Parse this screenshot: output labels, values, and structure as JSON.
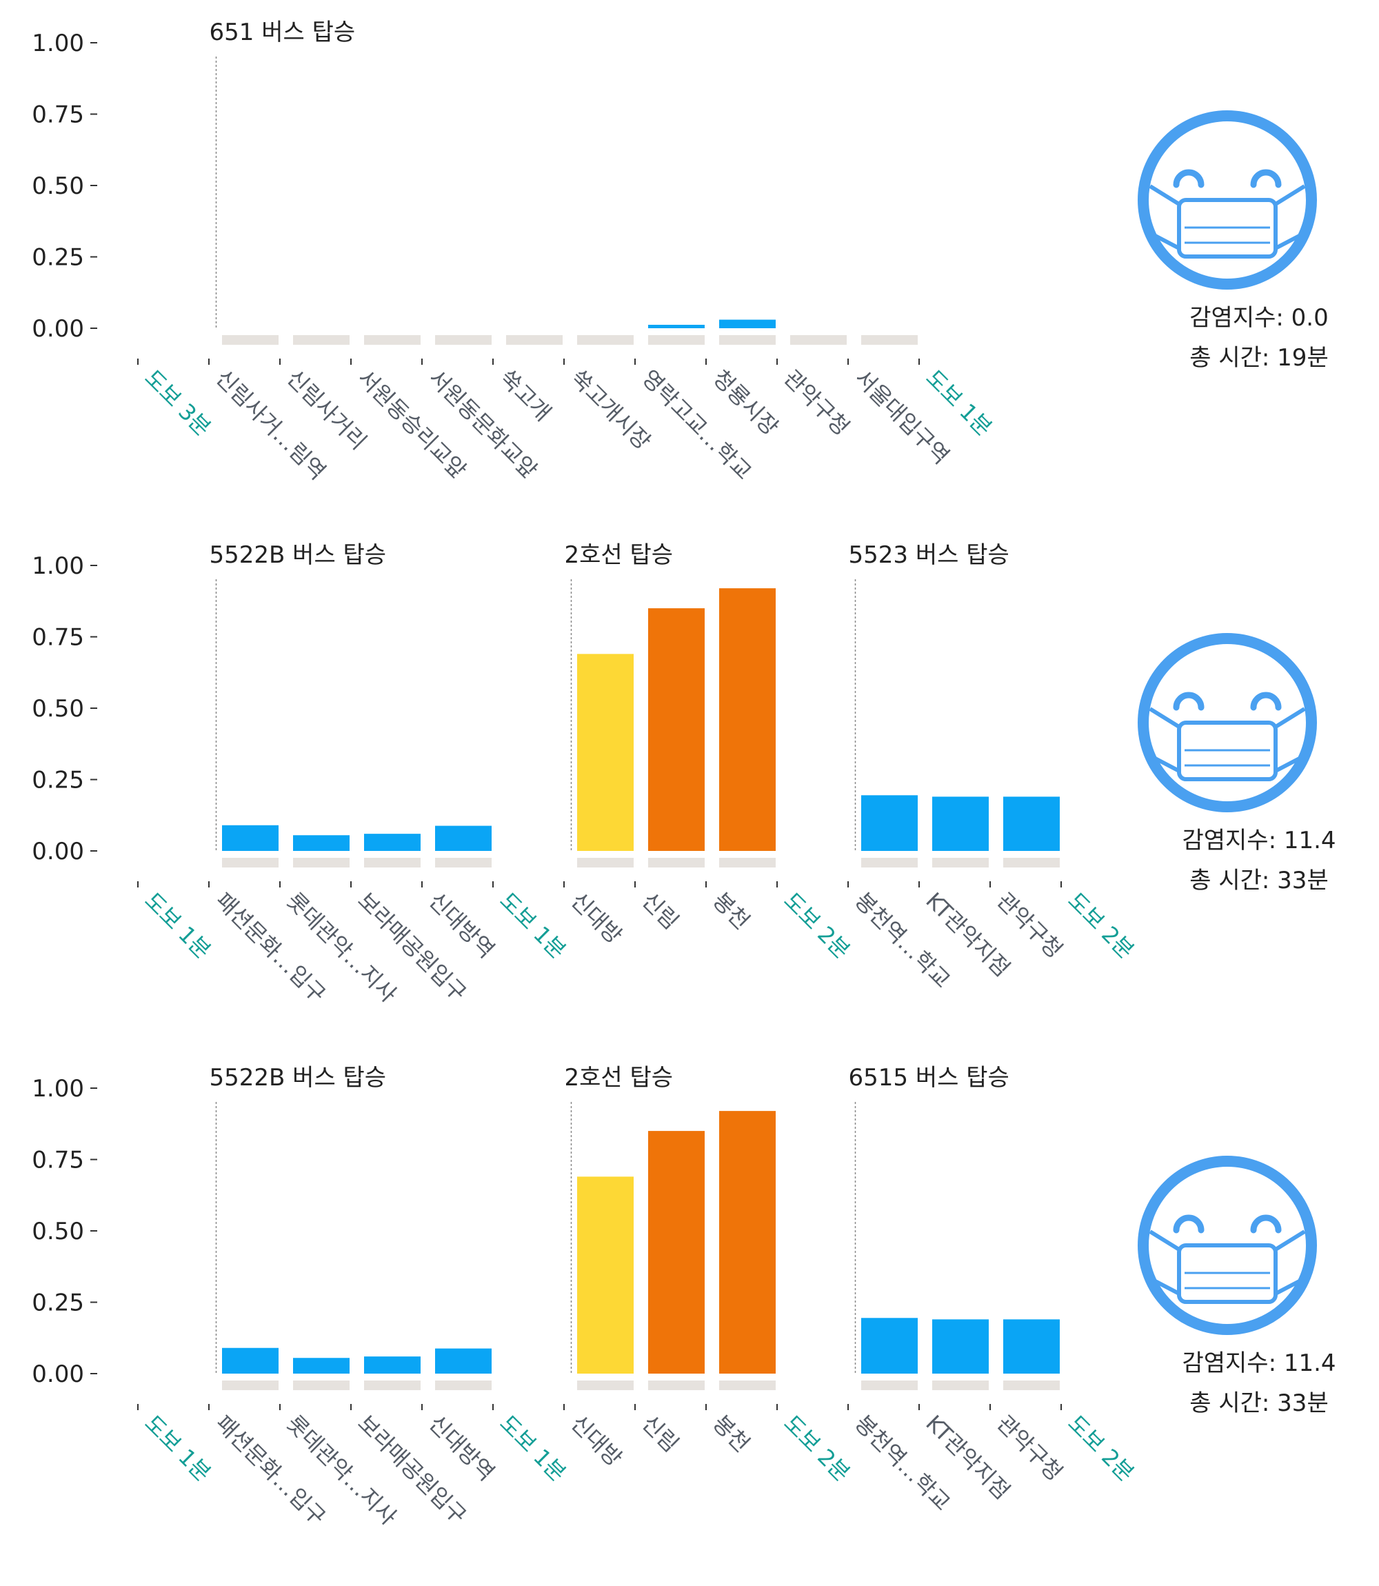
{
  "colors": {
    "bus": "#0aa5f5",
    "subway_low": "#fdd835",
    "subway_high": "#ef7409",
    "baseline": "#e6e2de",
    "walk_label": "#139e96",
    "stop_label": "#555c66",
    "icon": "#4aa0f0",
    "separator": "#888888"
  },
  "chart_data": [
    {
      "type": "bar",
      "ylim": [
        0,
        1
      ],
      "yticks": [
        "1.00",
        "0.75",
        "0.50",
        "0.25",
        "0.00"
      ],
      "walk_start": "도보 3분",
      "walk_end": "도보 1분",
      "legs": [
        {
          "label": "651 버스 탑승",
          "mode": "bus",
          "stops": [
            "신림사거…림역",
            "신림사거리",
            "서원동승리교앞",
            "서원동문화교앞",
            "쑥고개",
            "쑥고개시장",
            "영락고교…학교",
            "청룡시장",
            "관악구청",
            "서울대입구역"
          ],
          "values": [
            0,
            0,
            0,
            0,
            0,
            0,
            0.012,
            0.03,
            0,
            0
          ],
          "colors": [
            "bus",
            "bus",
            "bus",
            "bus",
            "bus",
            "bus",
            "bus",
            "bus",
            "bus",
            "bus"
          ],
          "walk_after": null
        }
      ],
      "infection_label": "감염지수: 0.0",
      "total_time_label": "총 시간: 19분",
      "icon": "mask-face-icon"
    },
    {
      "type": "bar",
      "ylim": [
        0,
        1
      ],
      "yticks": [
        "1.00",
        "0.75",
        "0.50",
        "0.25",
        "0.00"
      ],
      "walk_start": "도보 1분",
      "walk_end": "도보 2분",
      "legs": [
        {
          "label": "5522B 버스 탑승",
          "mode": "bus",
          "stops": [
            "패션문화…입구",
            "롯데관악…지사",
            "보라매공원입구",
            "신대방역"
          ],
          "values": [
            0.09,
            0.055,
            0.06,
            0.088
          ],
          "colors": [
            "bus",
            "bus",
            "bus",
            "bus"
          ],
          "walk_after": "도보 1분"
        },
        {
          "label": "2호선 탑승",
          "mode": "subway",
          "stops": [
            "신대방",
            "신림",
            "봉천"
          ],
          "values": [
            0.69,
            0.85,
            0.92
          ],
          "colors": [
            "subway_low",
            "subway_high",
            "subway_high"
          ],
          "walk_after": "도보 2분"
        },
        {
          "label": "5523 버스 탑승",
          "mode": "bus",
          "stops": [
            "봉천역…학교",
            "KT관악지점",
            "관악구청"
          ],
          "values": [
            0.195,
            0.19,
            0.19
          ],
          "colors": [
            "bus",
            "bus",
            "bus"
          ],
          "walk_after": null
        }
      ],
      "infection_label": "감염지수: 11.4",
      "total_time_label": "총 시간: 33분",
      "icon": "mask-face-icon"
    },
    {
      "type": "bar",
      "ylim": [
        0,
        1
      ],
      "yticks": [
        "1.00",
        "0.75",
        "0.50",
        "0.25",
        "0.00"
      ],
      "walk_start": "도보 1분",
      "walk_end": "도보 2분",
      "legs": [
        {
          "label": "5522B 버스 탑승",
          "mode": "bus",
          "stops": [
            "패션문화…입구",
            "롯데관악…지사",
            "보라매공원입구",
            "신대방역"
          ],
          "values": [
            0.09,
            0.055,
            0.06,
            0.088
          ],
          "colors": [
            "bus",
            "bus",
            "bus",
            "bus"
          ],
          "walk_after": "도보 1분"
        },
        {
          "label": "2호선 탑승",
          "mode": "subway",
          "stops": [
            "신대방",
            "신림",
            "봉천"
          ],
          "values": [
            0.69,
            0.85,
            0.92
          ],
          "colors": [
            "subway_low",
            "subway_high",
            "subway_high"
          ],
          "walk_after": "도보 2분"
        },
        {
          "label": "6515 버스 탑승",
          "mode": "bus",
          "stops": [
            "봉천역…학교",
            "KT관악지점",
            "관악구청"
          ],
          "values": [
            0.195,
            0.19,
            0.19
          ],
          "colors": [
            "bus",
            "bus",
            "bus"
          ],
          "walk_after": null
        }
      ],
      "infection_label": "감염지수: 11.4",
      "total_time_label": "총 시간: 33분",
      "icon": "mask-face-icon"
    }
  ]
}
